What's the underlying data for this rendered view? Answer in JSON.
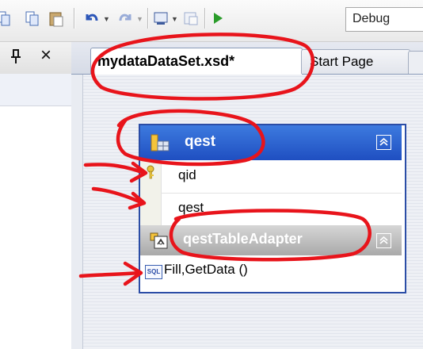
{
  "toolbar": {
    "configuration": "Debug",
    "icons": [
      "copy-icon",
      "paste-icon",
      "undo-icon",
      "redo-icon",
      "toolbox-icon",
      "properties-icon",
      "start-debugging-icon"
    ]
  },
  "left_panel": {
    "pin_glyph": "Ԅ",
    "close_glyph": "×"
  },
  "tabs": [
    {
      "label": "mydataDataSet.xsd*",
      "active": true
    },
    {
      "label": "Start Page",
      "active": false
    }
  ],
  "datatable": {
    "name": "qest",
    "columns": [
      {
        "name": "qid",
        "primary_key": true
      },
      {
        "name": "qest",
        "primary_key": false
      }
    ],
    "adapter": {
      "name": "qestTableAdapter",
      "queries": [
        "Fill,GetData ()"
      ],
      "query_icon_text": "SQL"
    },
    "collapse_glyph": "⌃"
  },
  "colors": {
    "title_bar": "#2a5fd0",
    "adapter_bar": "#bdbdbd",
    "annotation": "#e8141b"
  }
}
